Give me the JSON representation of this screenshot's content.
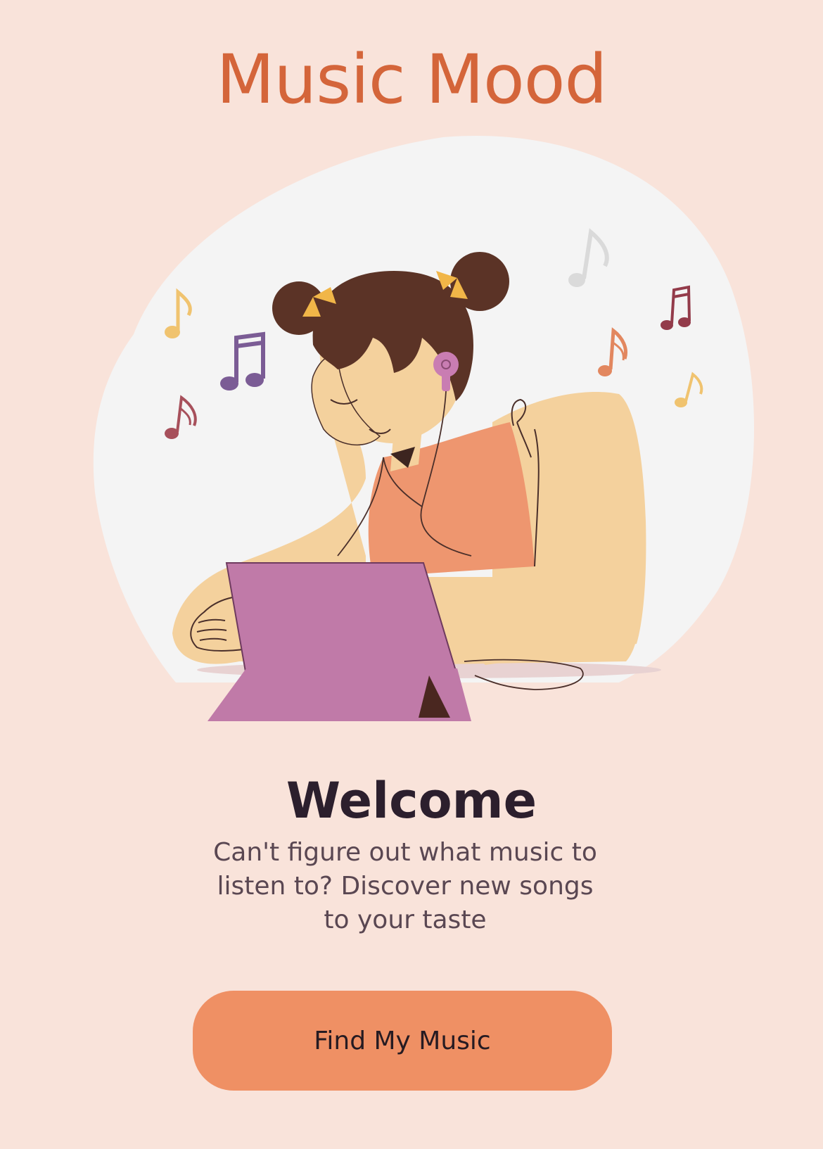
{
  "app": {
    "title": "Music Mood"
  },
  "welcome": {
    "heading": "Welcome",
    "description": "Can't figure out what music to listen to? Discover new songs to your taste"
  },
  "cta": {
    "label": "Find My Music"
  },
  "illustration": {
    "subject": "girl-listening-to-music-with-tablet-icon",
    "colors": {
      "background": "#f9e3da",
      "blob": "#f4f4f4",
      "skin": "#f4d19d",
      "hair": "#5b3326",
      "top": "#ee966f",
      "tablet": "#c07aa8",
      "earbud": "#c97db2",
      "accent_title": "#d4653a",
      "button": "#ef9064"
    }
  }
}
